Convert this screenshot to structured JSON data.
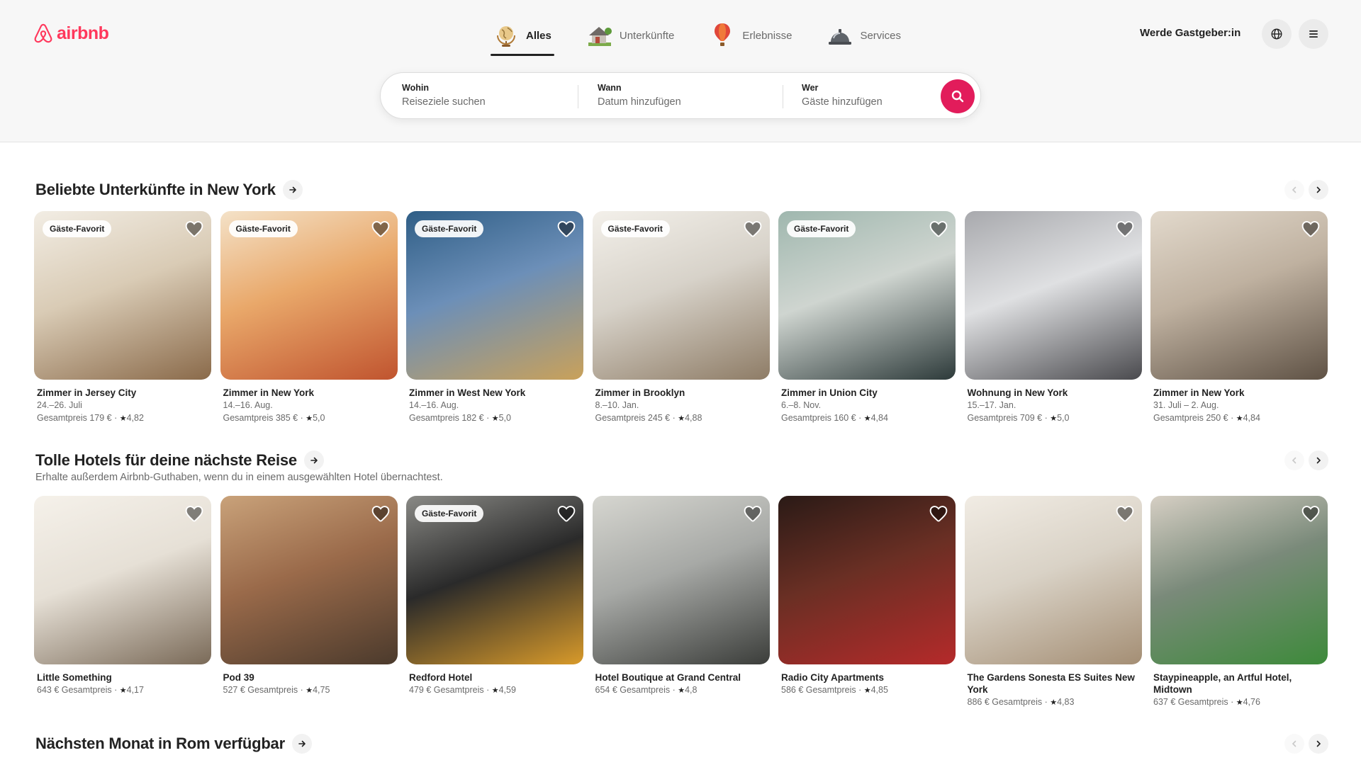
{
  "brand": {
    "name": "airbnb",
    "color": "#ff385c"
  },
  "nav": [
    {
      "label": "Alles",
      "icon": "globe-icon",
      "active": true
    },
    {
      "label": "Unterkünfte",
      "icon": "house-icon",
      "active": false
    },
    {
      "label": "Erlebnisse",
      "icon": "hot-air-balloon-icon",
      "active": false
    },
    {
      "label": "Services",
      "icon": "service-bell-icon",
      "active": false
    }
  ],
  "header": {
    "host_label": "Werde Gastgeber:in"
  },
  "search": {
    "where": {
      "label": "Wohin",
      "placeholder": "Reiseziele suchen"
    },
    "when": {
      "label": "Wann",
      "placeholder": "Datum hinzufügen"
    },
    "who": {
      "label": "Wer",
      "placeholder": "Gäste hinzufügen"
    },
    "button_color": "#e21c5b"
  },
  "sections": [
    {
      "title": "Beliebte Unterkünfte in New York",
      "listings": [
        {
          "badge": "Gäste-Favorit",
          "title": "Zimmer in Jersey City",
          "dates": "24.–26. Juli",
          "price": "Gesamtpreis 179 €",
          "rating": "4,82"
        },
        {
          "badge": "Gäste-Favorit",
          "title": "Zimmer in New York",
          "dates": "14.–16. Aug.",
          "price": "Gesamtpreis 385 €",
          "rating": "5,0"
        },
        {
          "badge": "Gäste-Favorit",
          "title": "Zimmer in West New York",
          "dates": "14.–16. Aug.",
          "price": "Gesamtpreis 182 €",
          "rating": "5,0"
        },
        {
          "badge": "Gäste-Favorit",
          "title": "Zimmer in Brooklyn",
          "dates": "8.–10. Jan.",
          "price": "Gesamtpreis 245 €",
          "rating": "4,88"
        },
        {
          "badge": "Gäste-Favorit",
          "title": "Zimmer in Union City",
          "dates": "6.–8. Nov.",
          "price": "Gesamtpreis 160 €",
          "rating": "4,84"
        },
        {
          "badge": "",
          "title": "Wohnung in New York",
          "dates": "15.–17. Jan.",
          "price": "Gesamtpreis 709 €",
          "rating": "5,0"
        },
        {
          "badge": "",
          "title": "Zimmer in New York",
          "dates": "31. Juli – 2. Aug.",
          "price": "Gesamtpreis 250 €",
          "rating": "4,84"
        }
      ]
    },
    {
      "title": "Tolle Hotels für deine nächste Reise",
      "subtitle": "Erhalte außerdem Airbnb-Guthaben, wenn du in einem ausgewählten Hotel übernachtest.",
      "listings": [
        {
          "badge": "",
          "title": "Little Something",
          "price": "643 € Gesamtpreis",
          "rating": "4,17"
        },
        {
          "badge": "",
          "title": "Pod 39",
          "price": "527 € Gesamtpreis",
          "rating": "4,75"
        },
        {
          "badge": "Gäste-Favorit",
          "title": "Redford Hotel",
          "price": "479 € Gesamtpreis",
          "rating": "4,59"
        },
        {
          "badge": "",
          "title": "Hotel Boutique at Grand Central",
          "price": "654 € Gesamtpreis",
          "rating": "4,8"
        },
        {
          "badge": "",
          "title": "Radio City Apartments",
          "price": "586 € Gesamtpreis",
          "rating": "4,85"
        },
        {
          "badge": "",
          "title": "The Gardens Sonesta ES Suites New York",
          "price": "886 € Gesamtpreis",
          "rating": "4,83"
        },
        {
          "badge": "",
          "title": "Staypineapple, an Artful Hotel, Midtown",
          "price": "637 € Gesamtpreis",
          "rating": "4,76"
        }
      ]
    },
    {
      "title": "Nächsten Monat in Rom verfügbar"
    }
  ],
  "image_palettes": [
    [
      "#d9cbb5",
      "#8a6a4a",
      "#f2ede4"
    ],
    [
      "#e9a86a",
      "#c0542f",
      "#f4e2c8"
    ],
    [
      "#6c8fb8",
      "#c9a15a",
      "#2f5e86"
    ],
    [
      "#d7d2c9",
      "#8e7c66",
      "#f3f0ea"
    ],
    [
      "#cfd5d0",
      "#2d3a3a",
      "#9fb7ae"
    ],
    [
      "#dfe0e2",
      "#4a4a4e",
      "#a8a9ad"
    ],
    [
      "#bfb1a0",
      "#5f5245",
      "#e2d9cc"
    ],
    [
      "#e6e0d6",
      "#7a6a58",
      "#f5f1ea"
    ],
    [
      "#9a6a4a",
      "#4b3a2c",
      "#c9a27a"
    ],
    [
      "#2a2a2a",
      "#d89a2a",
      "#8a8a86"
    ],
    [
      "#a7a9a6",
      "#3b3d3a",
      "#d6d6d0"
    ],
    [
      "#6a2f24",
      "#b52a2a",
      "#2a1a16"
    ],
    [
      "#d9d2c6",
      "#a48e74",
      "#f1ece4"
    ],
    [
      "#7a8a7a",
      "#3d8a3a",
      "#d6cfc4"
    ]
  ]
}
